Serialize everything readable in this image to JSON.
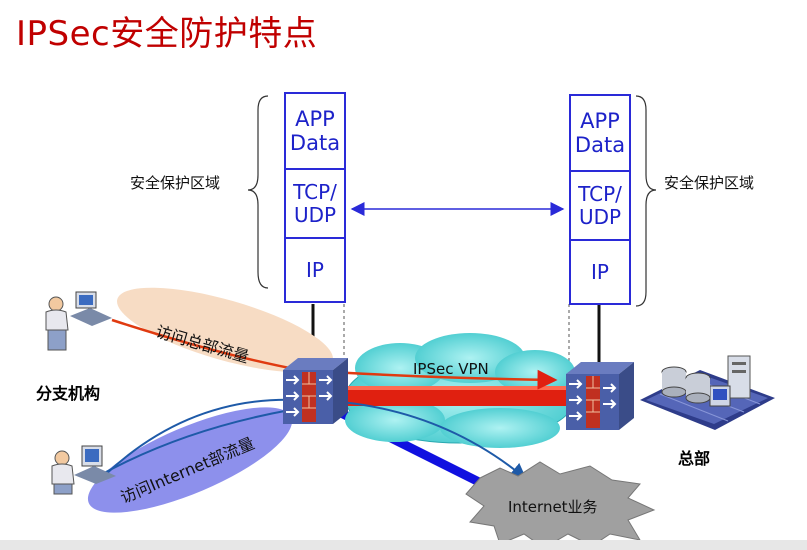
{
  "title": "IPSec安全防护特点",
  "left_stack": {
    "app": "APP",
    "data": "Data",
    "tcp": "TCP/",
    "udp": "UDP",
    "ip": "IP"
  },
  "right_stack": {
    "app": "APP",
    "data": "Data",
    "tcp": "TCP/",
    "udp": "UDP",
    "ip": "IP"
  },
  "zone_left": "安全保护区域",
  "zone_right": "安全保护区域",
  "branch_label": "分支机构",
  "hq_label": "总部",
  "flow_hq_label": "访问总部流量",
  "flow_internet_label": "访问Internet部流量",
  "vpn_label": "IPSec VPN",
  "internet_label": "Internet业务",
  "colors": {
    "title": "#c00000",
    "stack": "#2a2ad8",
    "cloud": "#7fe0e0",
    "tunnel": "#e02010",
    "internet_link": "#1010e0"
  }
}
